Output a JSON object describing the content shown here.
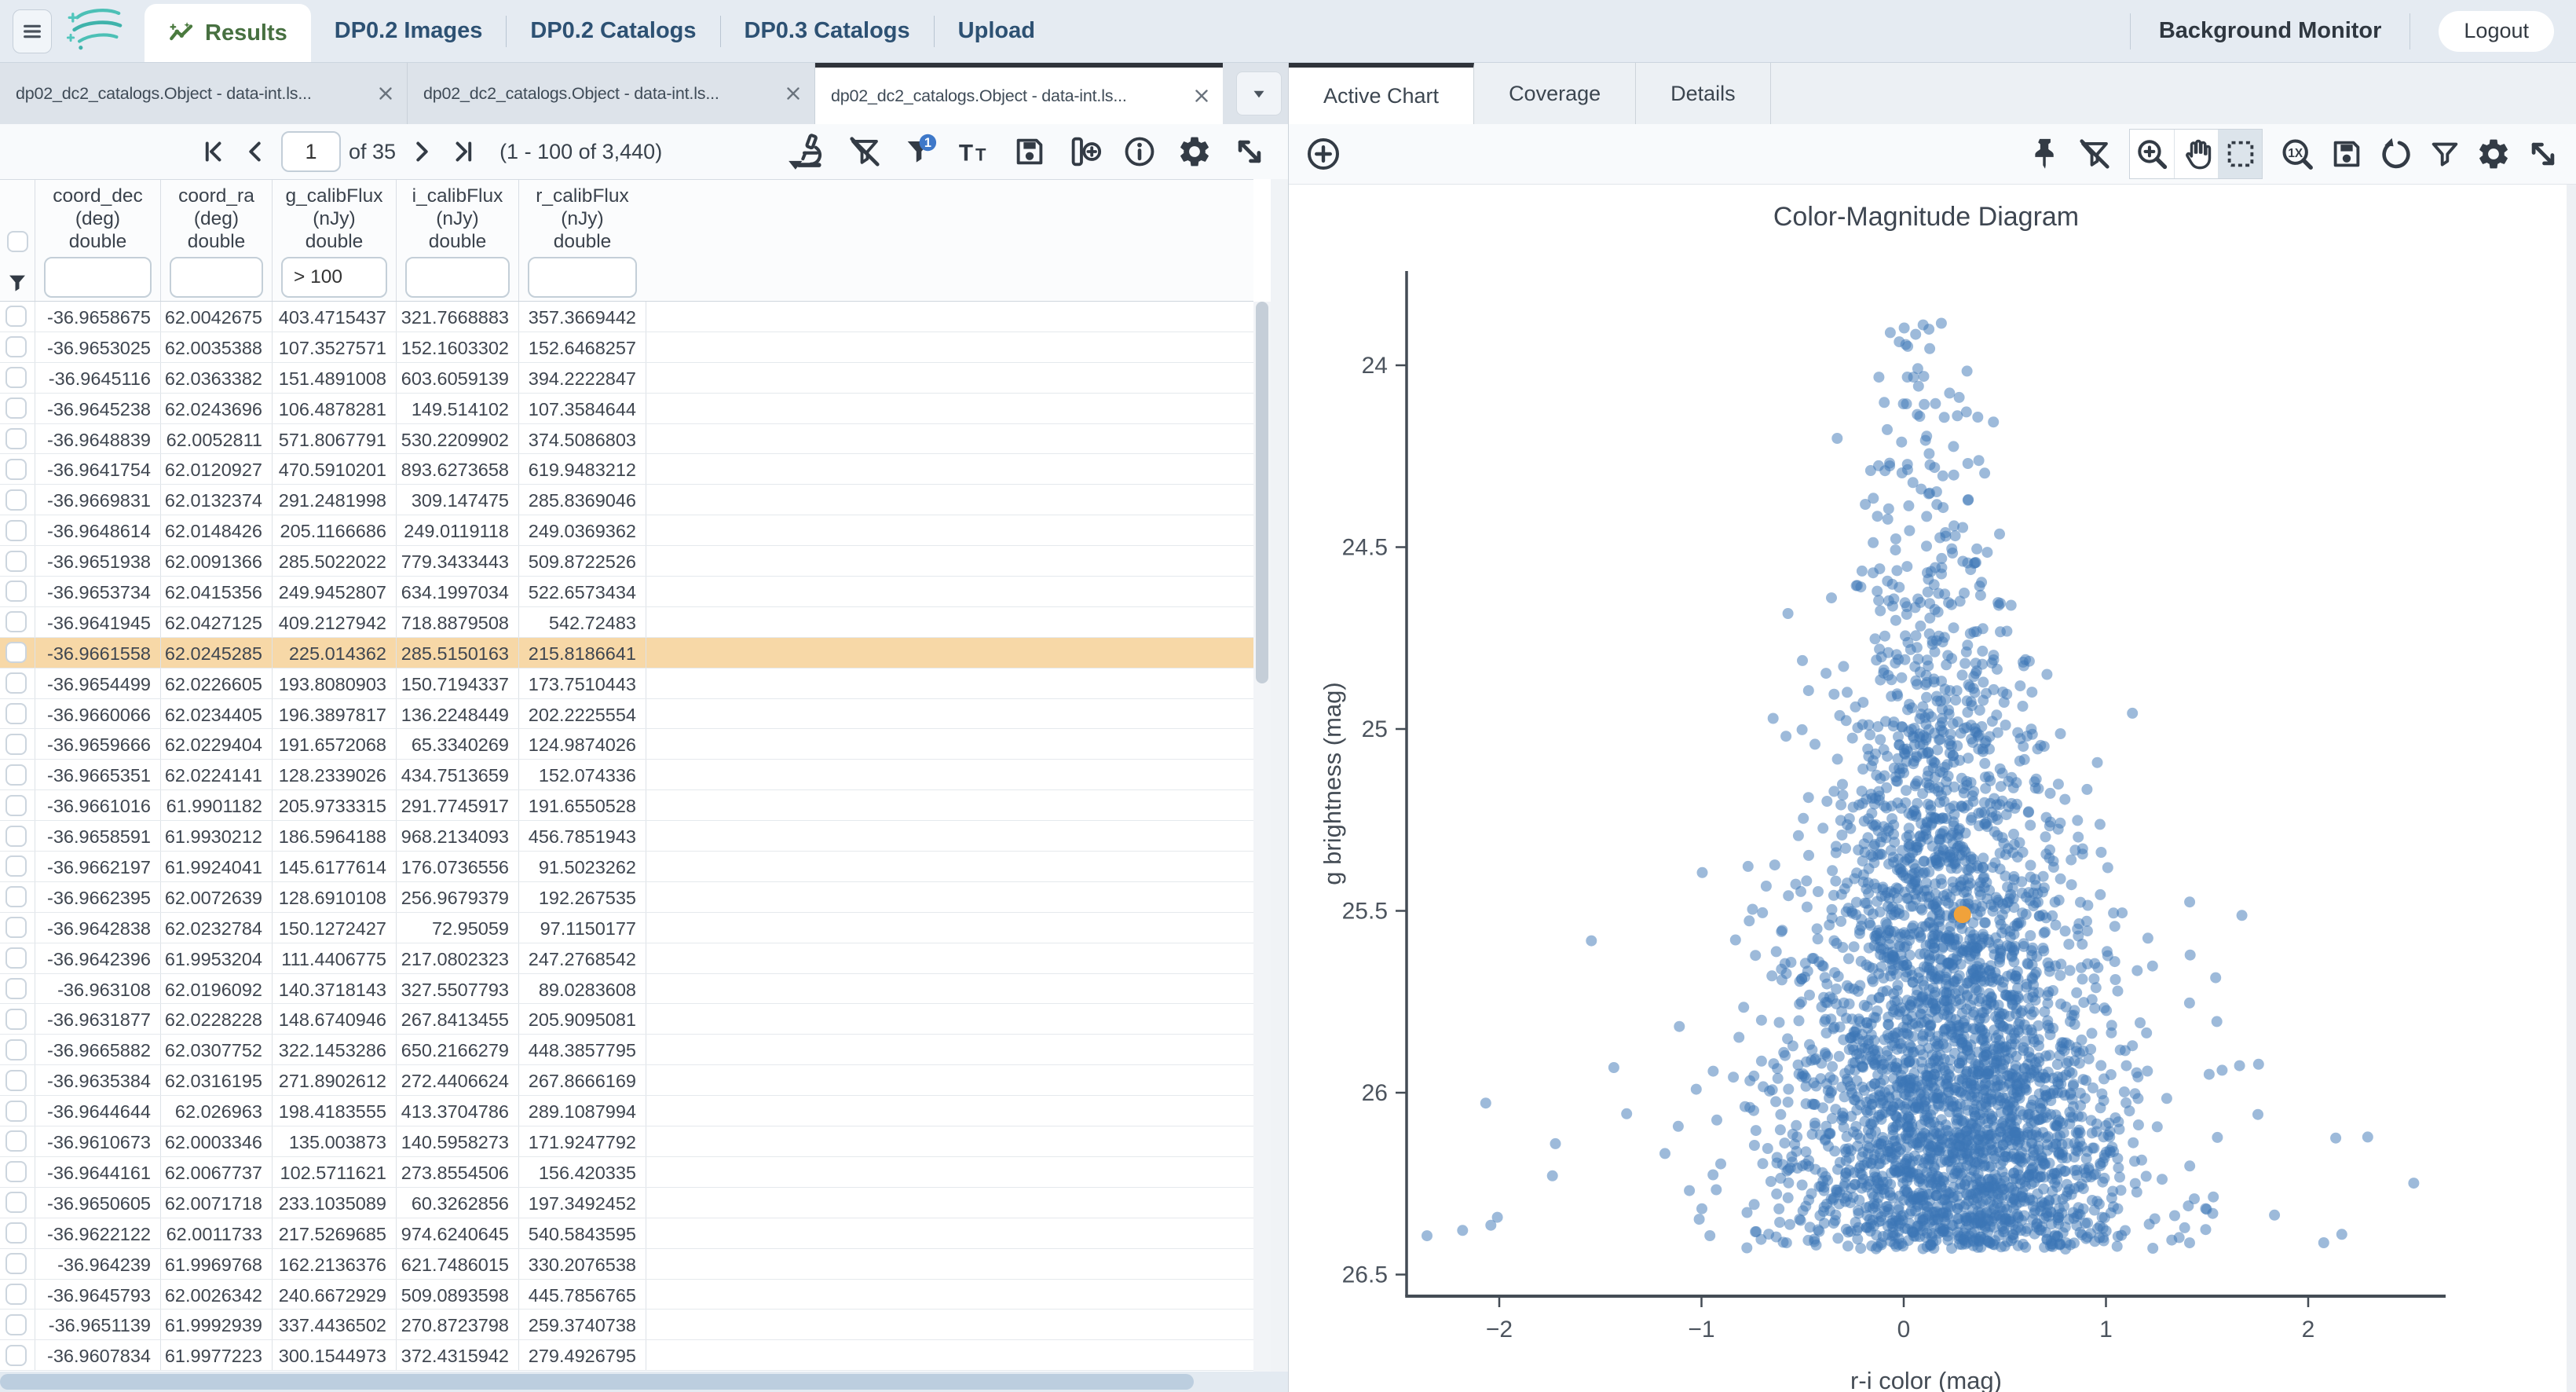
{
  "header": {
    "nav_tabs": [
      {
        "label": "Results",
        "active": true
      },
      {
        "label": "DP0.2 Images",
        "active": false
      },
      {
        "label": "DP0.2 Catalogs",
        "active": false
      },
      {
        "label": "DP0.3 Catalogs",
        "active": false
      },
      {
        "label": "Upload",
        "active": false
      }
    ],
    "background_monitor": "Background Monitor",
    "logout": "Logout"
  },
  "left_panel": {
    "tabs": [
      {
        "title": "dp02_dc2_catalogs.Object - data-int.ls...",
        "active": false
      },
      {
        "title": "dp02_dc2_catalogs.Object - data-int.ls...",
        "active": false
      },
      {
        "title": "dp02_dc2_catalogs.Object - data-int.ls...",
        "active": true
      }
    ],
    "pagination": {
      "page": "1",
      "of_label": "of 35",
      "range_label": "(1 - 100 of 3,440)"
    },
    "toolbar_icons": [
      "microscope-dropdown",
      "filter-clear",
      "filter-applied",
      "text-columns",
      "save",
      "add-column",
      "info",
      "settings",
      "expand"
    ],
    "filter_badge": "1",
    "table": {
      "columns": [
        {
          "name": "coord_dec",
          "unit": "(deg)",
          "type": "double",
          "filter": ""
        },
        {
          "name": "coord_ra",
          "unit": "(deg)",
          "type": "double",
          "filter": ""
        },
        {
          "name": "g_calibFlux",
          "unit": "(nJy)",
          "type": "double",
          "filter": "> 100"
        },
        {
          "name": "i_calibFlux",
          "unit": "(nJy)",
          "type": "double",
          "filter": ""
        },
        {
          "name": "r_calibFlux",
          "unit": "(nJy)",
          "type": "double",
          "filter": ""
        }
      ],
      "selected_row_index": 11,
      "rows": [
        [
          "-36.9658675",
          "62.0042675",
          "403.4715437",
          "321.7668883",
          "357.3669442"
        ],
        [
          "-36.9653025",
          "62.0035388",
          "107.3527571",
          "152.1603302",
          "152.6468257"
        ],
        [
          "-36.9645116",
          "62.0363382",
          "151.4891008",
          "603.6059139",
          "394.2222847"
        ],
        [
          "-36.9645238",
          "62.0243696",
          "106.4878281",
          "149.514102",
          "107.3584644"
        ],
        [
          "-36.9648839",
          "62.0052811",
          "571.8067791",
          "530.2209902",
          "374.5086803"
        ],
        [
          "-36.9641754",
          "62.0120927",
          "470.5910201",
          "893.6273658",
          "619.9483212"
        ],
        [
          "-36.9669831",
          "62.0132374",
          "291.2481998",
          "309.147475",
          "285.8369046"
        ],
        [
          "-36.9648614",
          "62.0148426",
          "205.1166686",
          "249.0119118",
          "249.0369362"
        ],
        [
          "-36.9651938",
          "62.0091366",
          "285.5022022",
          "779.3433443",
          "509.8722526"
        ],
        [
          "-36.9653734",
          "62.0415356",
          "249.9452807",
          "634.1997034",
          "522.6573434"
        ],
        [
          "-36.9641945",
          "62.0427125",
          "409.2127942",
          "718.8879508",
          "542.72483"
        ],
        [
          "-36.9661558",
          "62.0245285",
          "225.014362",
          "285.5150163",
          "215.8186641"
        ],
        [
          "-36.9654499",
          "62.0226605",
          "193.8080903",
          "150.7194337",
          "173.7510443"
        ],
        [
          "-36.9660066",
          "62.0234405",
          "196.3897817",
          "136.2248449",
          "202.2225554"
        ],
        [
          "-36.9659666",
          "62.0229404",
          "191.6572068",
          "65.3340269",
          "124.9874026"
        ],
        [
          "-36.9665351",
          "62.0224141",
          "128.2339026",
          "434.7513659",
          "152.074336"
        ],
        [
          "-36.9661016",
          "61.9901182",
          "205.9733315",
          "291.7745917",
          "191.6550528"
        ],
        [
          "-36.9658591",
          "61.9930212",
          "186.5964188",
          "968.2134093",
          "456.7851943"
        ],
        [
          "-36.9662197",
          "61.9924041",
          "145.6177614",
          "176.0736556",
          "91.5023262"
        ],
        [
          "-36.9662395",
          "62.0072639",
          "128.6910108",
          "256.9679379",
          "192.267535"
        ],
        [
          "-36.9642838",
          "62.0232784",
          "150.1272427",
          "72.95059",
          "97.1150177"
        ],
        [
          "-36.9642396",
          "61.9953204",
          "111.4406775",
          "217.0802323",
          "247.2768542"
        ],
        [
          "-36.963108",
          "62.0196092",
          "140.3718143",
          "327.5507793",
          "89.0283608"
        ],
        [
          "-36.9631877",
          "62.0228228",
          "148.6740946",
          "267.8413455",
          "205.9095081"
        ],
        [
          "-36.9665882",
          "62.0307752",
          "322.1453286",
          "650.2166279",
          "448.3857795"
        ],
        [
          "-36.9635384",
          "62.0316195",
          "271.8902612",
          "272.4406624",
          "267.8666169"
        ],
        [
          "-36.9644644",
          "62.026963",
          "198.4183555",
          "413.3704786",
          "289.1087994"
        ],
        [
          "-36.9610673",
          "62.0003346",
          "135.003873",
          "140.5958273",
          "171.9247792"
        ],
        [
          "-36.9644161",
          "62.0067737",
          "102.5711621",
          "273.8554506",
          "156.420335"
        ],
        [
          "-36.9650605",
          "62.0071718",
          "233.1035089",
          "60.3262856",
          "197.3492452"
        ],
        [
          "-36.9622122",
          "62.0011733",
          "217.5269685",
          "974.6240645",
          "540.5843595"
        ],
        [
          "-36.964239",
          "61.9969768",
          "162.2136376",
          "621.7486015",
          "330.2076538"
        ],
        [
          "-36.9645793",
          "62.0026342",
          "240.6672929",
          "509.0893598",
          "445.7856765"
        ],
        [
          "-36.9651139",
          "61.9992939",
          "337.4436502",
          "270.8723798",
          "259.3740738"
        ],
        [
          "-36.9607834",
          "61.9977223",
          "300.1544973",
          "372.4315942",
          "279.4926795"
        ]
      ]
    }
  },
  "right_panel": {
    "tabs": [
      {
        "label": "Active Chart",
        "active": true
      },
      {
        "label": "Coverage",
        "active": false
      },
      {
        "label": "Details",
        "active": false
      }
    ],
    "toolbar_icons_left": [
      "add-chart"
    ],
    "toolbar_icons_right": [
      "pin",
      "filter-clear",
      "zoom-in",
      "pan",
      "select-area",
      "zoom-1x",
      "save",
      "restore",
      "filter",
      "settings",
      "expand"
    ],
    "selected_tool": "select-area"
  },
  "chart_data": {
    "type": "scatter",
    "title": "Color-Magnitude Diagram",
    "xlabel": "r-i color (mag)",
    "ylabel": "g brightness (mag)",
    "x_ticks": [
      "-2",
      "-1",
      "0",
      "1",
      "2"
    ],
    "x_tick_values": [
      -2,
      -1,
      0,
      1,
      2
    ],
    "y_ticks": [
      "24",
      "24.5",
      "25",
      "25.5",
      "26",
      "26.5"
    ],
    "y_tick_values": [
      24,
      24.5,
      25,
      25.5,
      26,
      26.5
    ],
    "x_range": [
      -2.47,
      2.68
    ],
    "y_range_top_to_bottom": [
      23.74,
      26.56
    ],
    "y_axis_inverted": true,
    "n_points": 3440,
    "marker_color": "#3c76b5",
    "marker_opacity": 0.5,
    "selected_point": {
      "x": 0.29,
      "y": 25.51,
      "color": "#f0a23b"
    },
    "distribution": {
      "seed": 11,
      "y_top": 23.88,
      "y_cut": 26.43,
      "core_frac": 0.62,
      "core_sigma": 0.68,
      "tail_sigma": 1.08,
      "x_center_top": 0.05,
      "x_center_bottom": 0.3,
      "x_sigma_top": 0.15,
      "x_sigma_bottom": 0.45,
      "outlier_frac_bottom": 0.055,
      "outlier_sigma": 0.95,
      "x_min": -2.45,
      "x_max": 2.62
    }
  }
}
